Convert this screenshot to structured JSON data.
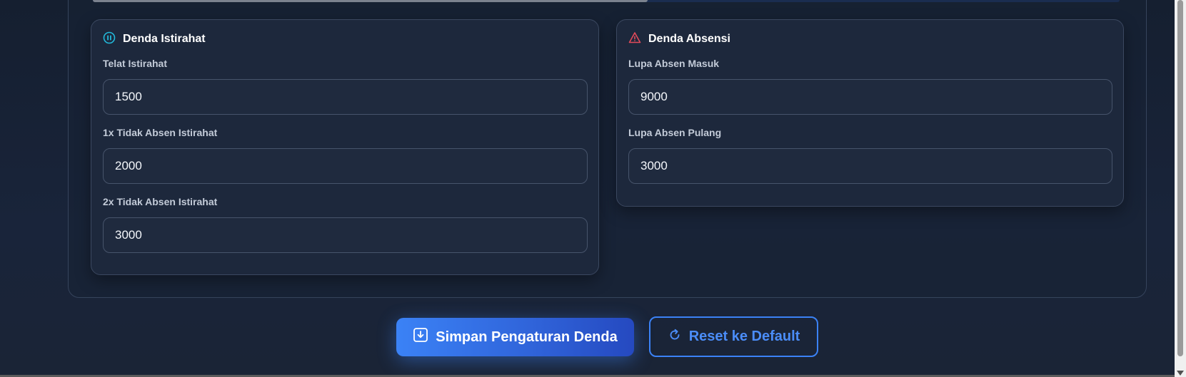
{
  "progress": {
    "fraction": 0.54
  },
  "istirahat": {
    "title": "Denda Istirahat",
    "icon": "pause-circle-icon",
    "accent": "#22b8d9",
    "fields": [
      {
        "label": "Telat Istirahat",
        "value": "1500"
      },
      {
        "label": "1x Tidak Absen Istirahat",
        "value": "2000"
      },
      {
        "label": "2x Tidak Absen Istirahat",
        "value": "3000"
      }
    ]
  },
  "absensi": {
    "title": "Denda Absensi",
    "icon": "warning-triangle-icon",
    "accent": "#e24a5a",
    "fields": [
      {
        "label": "Lupa Absen Masuk",
        "value": "9000"
      },
      {
        "label": "Lupa Absen Pulang",
        "value": "3000"
      }
    ]
  },
  "actions": {
    "save_label": "Simpan Pengaturan Denda",
    "save_icon": "download-save-icon",
    "reset_label": "Reset ke Default",
    "reset_icon": "refresh-icon",
    "primary_color": "#3b82f6"
  }
}
